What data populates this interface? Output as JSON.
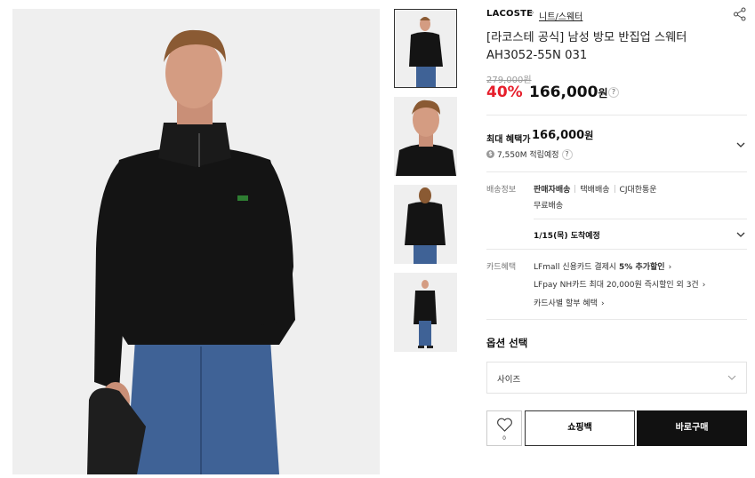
{
  "product": {
    "brand": "LACOSTE",
    "breadcrumb_sep": "›",
    "category": "니트/스웨터",
    "title": "[라코스테 공식] 남성 방모 반집업 스웨터 AH3052-55N 031",
    "original_price": "279,000원",
    "discount": "40%",
    "price": "166,000",
    "price_unit": "원",
    "help": "?"
  },
  "benefit": {
    "label": "최대 혜택가",
    "price": "166,000",
    "price_unit": "원",
    "coin": "$",
    "points": "7,550M 적립예정",
    "help": "?"
  },
  "shipping": {
    "label": "배송정보",
    "seller": "판매자배송",
    "type": "택배배송",
    "carrier": "CJ대한통운",
    "fee": "무료배송",
    "arrival": "1/15(목) 도착예정"
  },
  "card": {
    "label": "카드혜택",
    "line1_pre": "LFmall 신용카드 결제시 ",
    "line1_bold": "5% 추가할인",
    "line2": "LFpay NH카드 최대 20,000원 즉시할인 외 3건",
    "line3": "카드사별 할부 혜택",
    "arrow": "›"
  },
  "options": {
    "title": "옵션 선택",
    "size_placeholder": "사이즈"
  },
  "actions": {
    "wish_count": "0",
    "shopping_bag": "쇼핑백",
    "buy_now": "바로구매"
  },
  "colors": {
    "discount_red": "#e61e2b",
    "sweater": "#121212",
    "jeans": "#3c5f94",
    "background": "#efefef"
  }
}
